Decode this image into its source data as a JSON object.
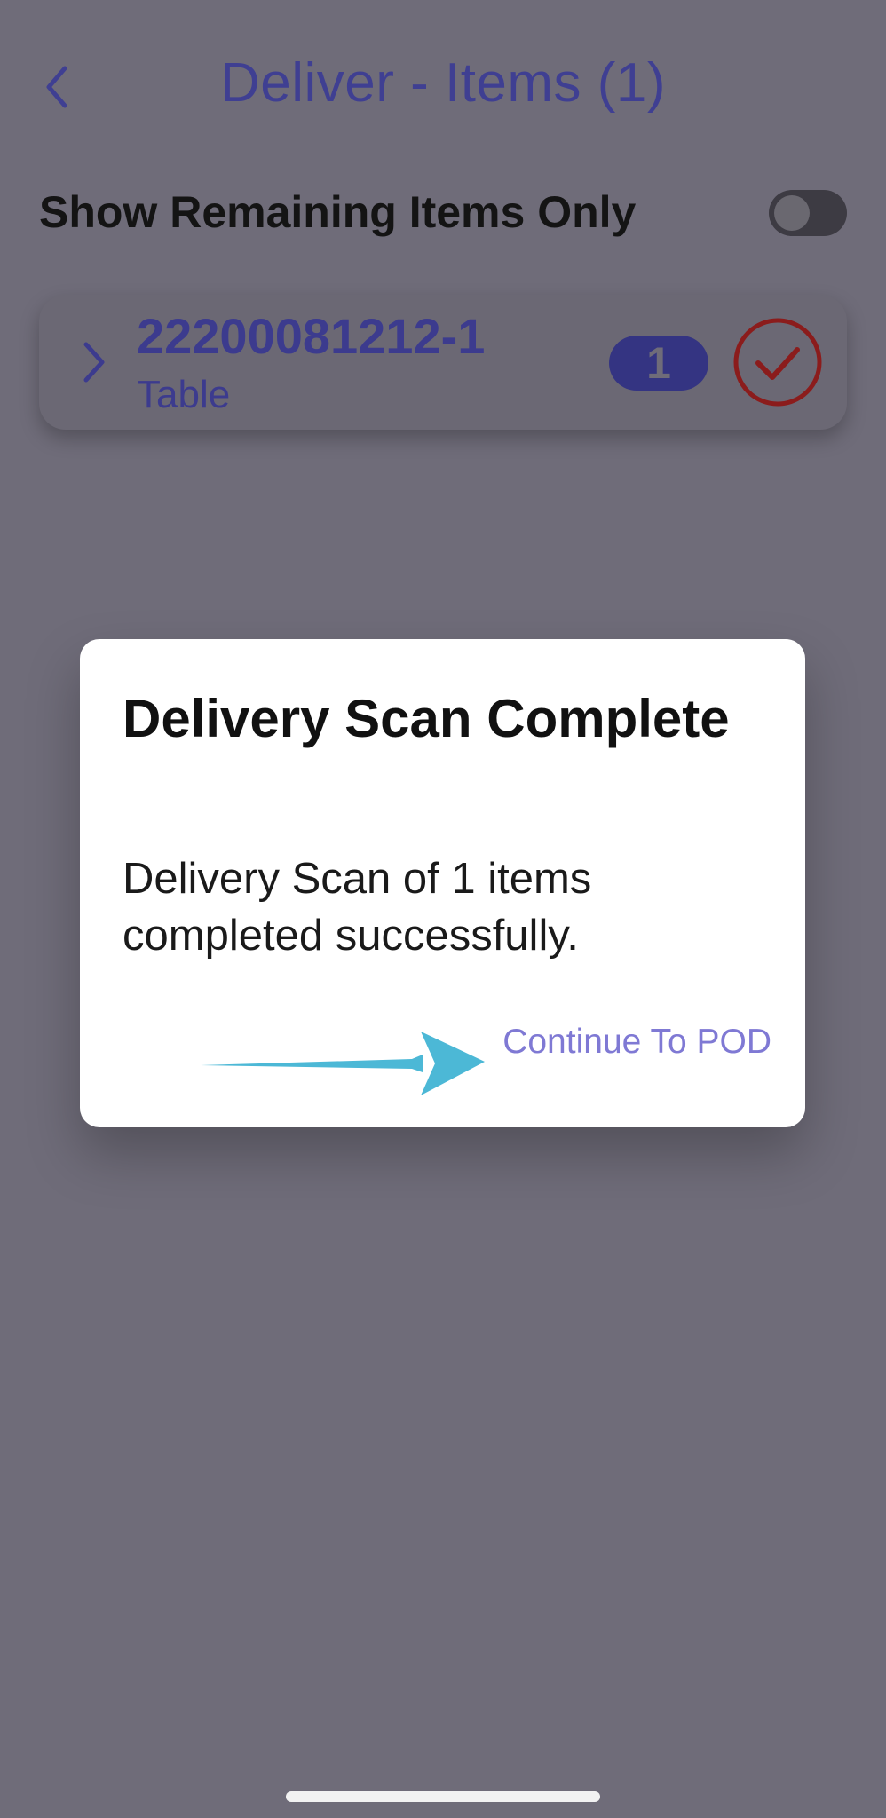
{
  "header": {
    "title": "Deliver - Items (1)",
    "back_icon": "chevron-left-icon"
  },
  "filter": {
    "label": "Show Remaining Items Only",
    "toggle_on": false
  },
  "items": [
    {
      "id": "22200081212-1",
      "description": "Table",
      "count": "1",
      "status_icon": "check-circle-icon",
      "expand_icon": "chevron-right-icon"
    }
  ],
  "dialog": {
    "title": "Delivery Scan Complete",
    "message": "Delivery Scan of 1 items completed successfully.",
    "action_label": "Continue To POD"
  },
  "colors": {
    "overlay_background": "#6f6c79",
    "title_color": "#3f3f92",
    "badge_color": "#343482",
    "check_color": "#8b1c1c",
    "action_color": "#7f79d4",
    "annotation_arrow": "#4cb8d6"
  }
}
